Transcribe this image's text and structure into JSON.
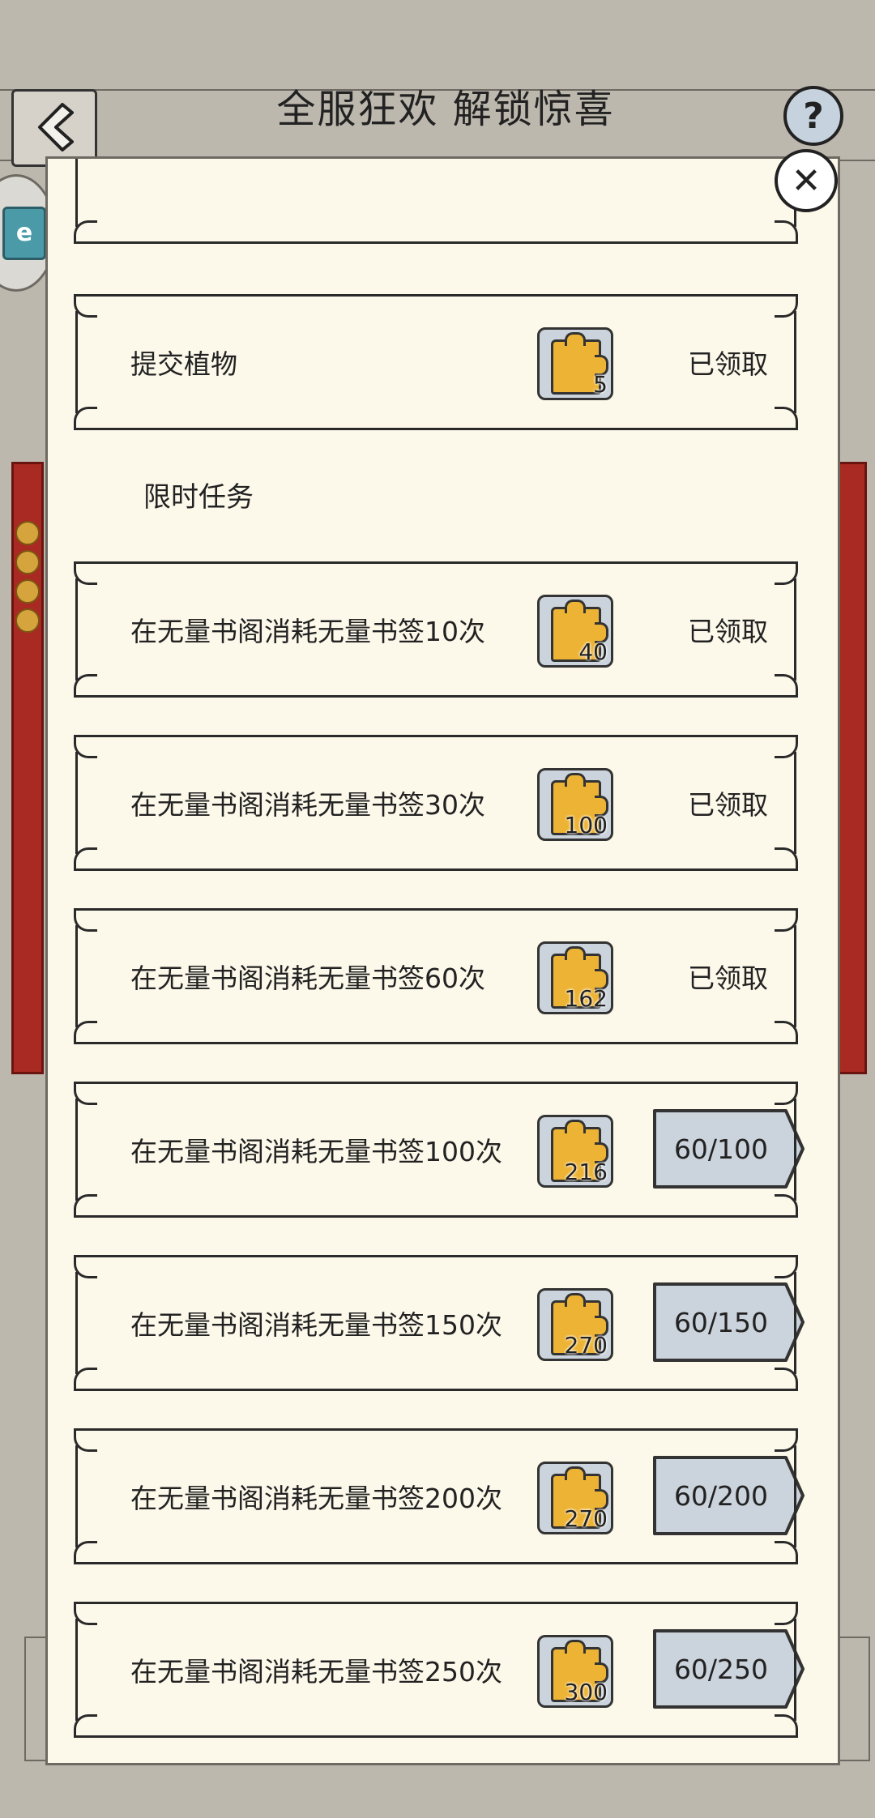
{
  "header": {
    "title": "全服狂欢 解锁惊喜",
    "help_label": "?",
    "close_label": "✕"
  },
  "side_badge_label": "e",
  "section": {
    "limited_tasks_label": "限时任务"
  },
  "tasks": [
    {
      "title": "提交植物",
      "reward": "5",
      "status": "已领取",
      "progress": ""
    },
    {
      "title": "在无量书阁消耗无量书签10次",
      "reward": "40",
      "status": "已领取",
      "progress": ""
    },
    {
      "title": "在无量书阁消耗无量书签30次",
      "reward": "100",
      "status": "已领取",
      "progress": ""
    },
    {
      "title": "在无量书阁消耗无量书签60次",
      "reward": "162",
      "status": "已领取",
      "progress": ""
    },
    {
      "title": "在无量书阁消耗无量书签100次",
      "reward": "216",
      "status": "",
      "progress": "60/100"
    },
    {
      "title": "在无量书阁消耗无量书签150次",
      "reward": "270",
      "status": "",
      "progress": "60/150"
    },
    {
      "title": "在无量书阁消耗无量书签200次",
      "reward": "270",
      "status": "",
      "progress": "60/200"
    },
    {
      "title": "在无量书阁消耗无量书签250次",
      "reward": "300",
      "status": "",
      "progress": "60/250"
    }
  ],
  "colors": {
    "panel": "#fcf8ea",
    "reward_bg": "#cbd3dc",
    "puzzle": "#edb334",
    "scroll": "#a92a22",
    "background": "#bdb8ae"
  },
  "icons": {
    "back": "back-arrow-icon",
    "help": "question-icon",
    "close": "close-icon",
    "reward": "puzzle-piece-icon"
  }
}
